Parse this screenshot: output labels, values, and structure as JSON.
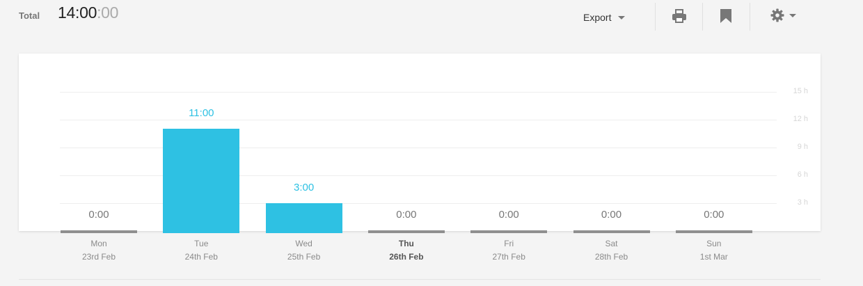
{
  "header": {
    "total_label": "Total",
    "total_time_main": "14:00",
    "total_time_seconds": ":00"
  },
  "toolbar": {
    "export_label": "Export",
    "icons": [
      "print-icon",
      "bookmark-icon",
      "gear-icon"
    ]
  },
  "colors": {
    "bar": "#2ec1e3",
    "bar_label": "#2ec1e3",
    "zero_bar": "#8f8f8f",
    "zero_label": "#777777"
  },
  "chart_data": {
    "type": "bar",
    "categories": [
      "Mon",
      "Tue",
      "Wed",
      "Thu",
      "Fri",
      "Sat",
      "Sun"
    ],
    "dates": [
      "23rd Feb",
      "24th Feb",
      "25th Feb",
      "26th Feb",
      "27th Feb",
      "28th Feb",
      "1st Mar"
    ],
    "values": [
      0,
      11,
      3,
      0,
      0,
      0,
      0
    ],
    "value_labels": [
      "0:00",
      "11:00",
      "3:00",
      "0:00",
      "0:00",
      "0:00",
      "0:00"
    ],
    "highlighted_day": "Thu",
    "yticks": [
      3,
      6,
      9,
      12,
      15
    ],
    "ytick_labels": [
      "3 h",
      "6 h",
      "9 h",
      "12 h",
      "15 h"
    ],
    "ylim": [
      0,
      15
    ],
    "ylabel": "",
    "xlabel": "",
    "grid": true
  }
}
